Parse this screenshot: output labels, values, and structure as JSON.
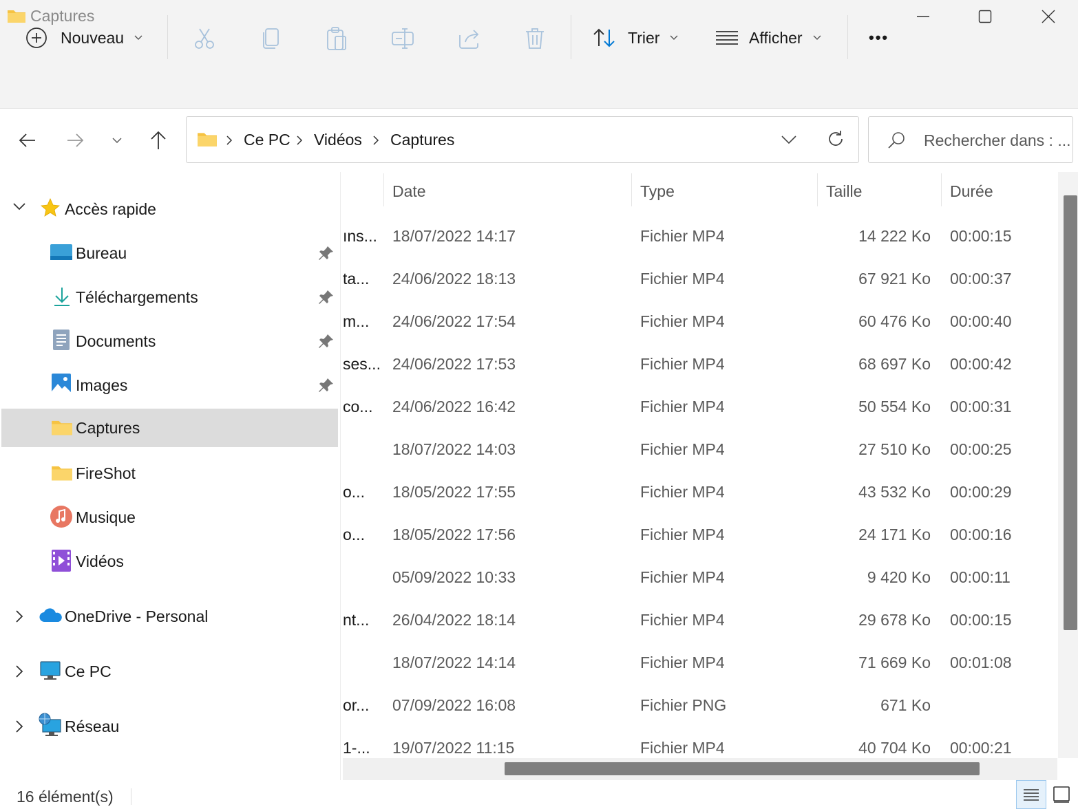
{
  "window": {
    "title": "Captures",
    "icon": "folder-icon",
    "controls": [
      "minimize-icon",
      "maximize-icon",
      "close-icon"
    ]
  },
  "toolbar": {
    "new_label": "Nouveau",
    "sort_label": "Trier",
    "view_label": "Afficher",
    "more_label": "•••",
    "icons": [
      "plus-circle-icon",
      "cut-icon",
      "copy-icon",
      "paste-icon",
      "rename-icon",
      "share-icon",
      "delete-icon",
      "sort-icon",
      "view-icon"
    ]
  },
  "address": {
    "crumbs": [
      "Ce PC",
      "Vidéos",
      "Captures"
    ],
    "search_placeholder": "Rechercher dans : ..."
  },
  "sidebar": {
    "quick_access": "Accès rapide",
    "items": [
      {
        "label": "Bureau",
        "icon": "desktop-icon",
        "pinned": true
      },
      {
        "label": "Téléchargements",
        "icon": "download-icon",
        "pinned": true
      },
      {
        "label": "Documents",
        "icon": "documents-icon",
        "pinned": true
      },
      {
        "label": "Images",
        "icon": "images-icon",
        "pinned": true
      },
      {
        "label": "Captures",
        "icon": "folder-icon",
        "pinned": false,
        "selected": true
      },
      {
        "label": "FireShot",
        "icon": "folder-icon",
        "pinned": false
      },
      {
        "label": "Musique",
        "icon": "music-icon",
        "pinned": false
      },
      {
        "label": "Vidéos",
        "icon": "videos-icon",
        "pinned": false
      }
    ],
    "onedrive": "OneDrive - Personal",
    "this_pc": "Ce PC",
    "network": "Réseau"
  },
  "files": {
    "columns": [
      "Date",
      "Type",
      "Taille",
      "Durée"
    ],
    "rows": [
      {
        "name": "ıns...",
        "date": "18/07/2022 14:17",
        "type": "Fichier MP4",
        "size": "14 222 Ko",
        "duration": "00:00:15"
      },
      {
        "name": "ta...",
        "date": "24/06/2022 18:13",
        "type": "Fichier MP4",
        "size": "67 921 Ko",
        "duration": "00:00:37"
      },
      {
        "name": "m...",
        "date": "24/06/2022 17:54",
        "type": "Fichier MP4",
        "size": "60 476 Ko",
        "duration": "00:00:40"
      },
      {
        "name": "ses...",
        "date": "24/06/2022 17:53",
        "type": "Fichier MP4",
        "size": "68 697 Ko",
        "duration": "00:00:42"
      },
      {
        "name": "co...",
        "date": "24/06/2022 16:42",
        "type": "Fichier MP4",
        "size": "50 554 Ko",
        "duration": "00:00:31"
      },
      {
        "name": "",
        "date": "18/07/2022 14:03",
        "type": "Fichier MP4",
        "size": "27 510 Ko",
        "duration": "00:00:25"
      },
      {
        "name": "o...",
        "date": "18/05/2022 17:55",
        "type": "Fichier MP4",
        "size": "43 532 Ko",
        "duration": "00:00:29"
      },
      {
        "name": "o...",
        "date": "18/05/2022 17:56",
        "type": "Fichier MP4",
        "size": "24 171 Ko",
        "duration": "00:00:16"
      },
      {
        "name": "",
        "date": "05/09/2022 10:33",
        "type": "Fichier MP4",
        "size": "9 420 Ko",
        "duration": "00:00:11"
      },
      {
        "name": "nt...",
        "date": "26/04/2022 18:14",
        "type": "Fichier MP4",
        "size": "29 678 Ko",
        "duration": "00:00:15"
      },
      {
        "name": "",
        "date": "18/07/2022 14:14",
        "type": "Fichier MP4",
        "size": "71 669 Ko",
        "duration": "00:01:08"
      },
      {
        "name": "or...",
        "date": "07/09/2022 16:08",
        "type": "Fichier PNG",
        "size": "671 Ko",
        "duration": ""
      },
      {
        "name": "1-...",
        "date": "19/07/2022 11:15",
        "type": "Fichier MP4",
        "size": "40 704 Ko",
        "duration": "00:00:21"
      }
    ]
  },
  "status": {
    "count": "16 élément(s)"
  },
  "colors": {
    "folder": "#f6c342",
    "accent": "#0078d4",
    "selection": "#dcdcdc"
  }
}
